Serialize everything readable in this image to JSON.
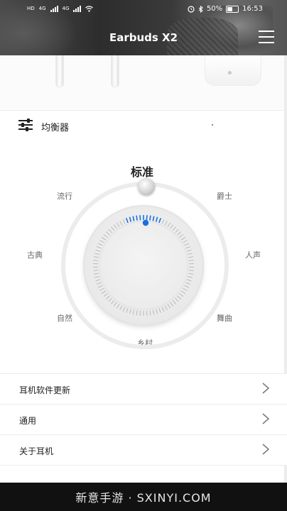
{
  "status_bar": {
    "network_tags": [
      "HD",
      "HD"
    ],
    "network_types": [
      "4G",
      "4G"
    ],
    "battery": "50%",
    "time": "16:53"
  },
  "app": {
    "title": "Earbuds X2"
  },
  "equalizer": {
    "section_title": "均衡器",
    "selected_preset": "标准",
    "presets": {
      "pop": "流行",
      "jazz": "爵士",
      "classical": "古典",
      "vocal": "人声",
      "natural": "自然",
      "dance": "舞曲",
      "country": "乡村"
    }
  },
  "settings_list": [
    {
      "label": "耳机软件更新"
    },
    {
      "label": "通用"
    },
    {
      "label": "关于耳机"
    }
  ],
  "watermark": "新意手游 · SXINYI.COM",
  "icons": [
    "menu-icon",
    "equalizer-sliders-icon",
    "chevron-right-icon",
    "battery-icon",
    "signal-icon",
    "wifi-icon",
    "alarm-icon",
    "bluetooth-icon"
  ],
  "colors": {
    "accent": "#1a6fe0",
    "header_bg": "#3a3a3a"
  }
}
